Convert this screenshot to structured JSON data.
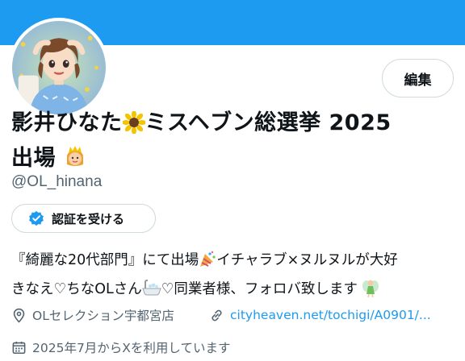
{
  "profile": {
    "edit_label": "編集",
    "name_line1_a": "影井ひなた",
    "name_line1_b": "ミスヘブン総選挙 2025",
    "name_line2": "出場",
    "handle": "@OL_hinana",
    "verify_label": "認証を受ける",
    "bio_line1_a": "『綺麗な20代部門』にて出場",
    "bio_line1_b": "イチャラブ×ヌルヌルが大好",
    "bio_line2_a": "きなえ♡ちなOLさん",
    "bio_line2_b": "♡同業者様、フォロバ致します",
    "location": "OLセレクション宇都宮店",
    "website": "cityheaven.net/tochigi/A0901/...",
    "joined": "2025年7月からXを利用しています"
  },
  "icons": {
    "avatar": "avatar-illustration",
    "sunflower": "sunflower-emoji-icon",
    "princess": "princess-crown-emoji-icon",
    "party": "party-popper-emoji-icon",
    "bathtub": "bathtub-emoji-icon",
    "fairy": "fairy-emoji-icon",
    "verified": "verified-badge-icon",
    "location": "location-pin-icon",
    "link": "link-icon",
    "calendar": "calendar-icon"
  },
  "colors": {
    "banner": "#1d9bf0",
    "link": "#1d9bf0",
    "secondary_text": "#536471",
    "border": "#cfd9de"
  }
}
